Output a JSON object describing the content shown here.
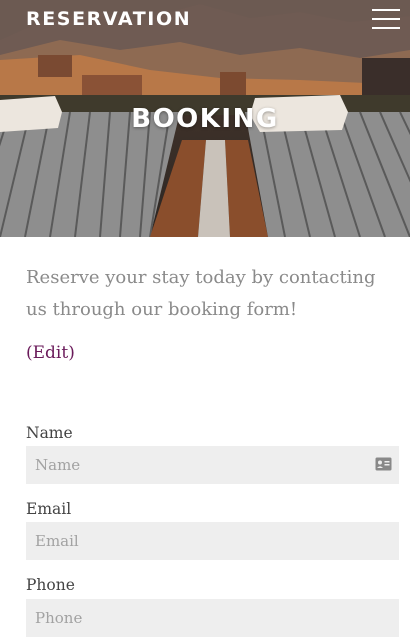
{
  "header": {
    "brand": "RESERVATION",
    "menu_icon": "hamburger-menu-icon"
  },
  "hero": {
    "title": "BOOKING",
    "image": "resort-pool-loungers-photo"
  },
  "intro": {
    "text": "Reserve your stay today by contacting us through our booking form!",
    "edit_link": "(Edit)"
  },
  "form": {
    "name": {
      "label": "Name",
      "placeholder": "Name",
      "icon": "contact-card-icon"
    },
    "email": {
      "label": "Email",
      "placeholder": "Email"
    },
    "phone": {
      "label": "Phone",
      "placeholder": "Phone"
    }
  },
  "colors": {
    "link": "#6a1a5a",
    "input_bg": "#eeeeee",
    "intro_text": "#8a8a8a"
  }
}
